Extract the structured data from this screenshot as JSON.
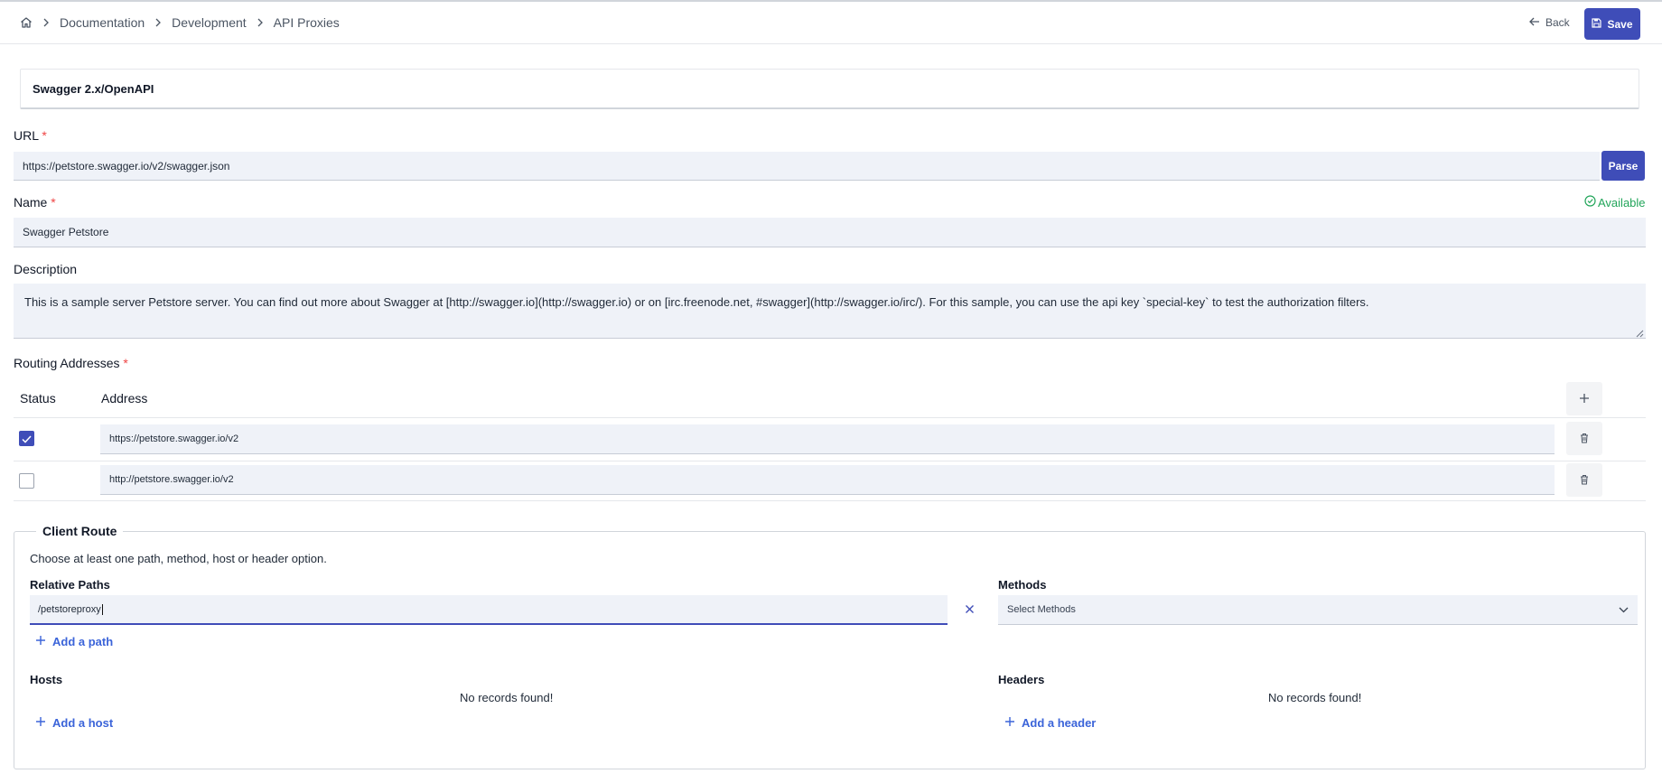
{
  "breadcrumb": {
    "items": [
      "Documentation",
      "Development",
      "API Proxies"
    ]
  },
  "header": {
    "back_label": "Back",
    "save_label": "Save"
  },
  "panel": {
    "title": "Swagger 2.x/OpenAPI"
  },
  "form": {
    "url_label": "URL",
    "url_value": "https://petstore.swagger.io/v2/swagger.json",
    "parse_label": "Parse",
    "name_label": "Name",
    "name_value": "Swagger Petstore",
    "name_status": "Available",
    "description_label": "Description",
    "description_value": "This is a sample server Petstore server.  You can find out more about Swagger at [http://swagger.io](http://swagger.io) or on [irc.freenode.net, #swagger](http://swagger.io/irc/).  For this sample, you can use the api key `special-key` to test the authorization filters.",
    "required_mark": "*"
  },
  "routing": {
    "label": "Routing Addresses",
    "col_status": "Status",
    "col_address": "Address",
    "rows": [
      {
        "checked": true,
        "address": "https://petstore.swagger.io/v2"
      },
      {
        "checked": false,
        "address": "http://petstore.swagger.io/v2"
      }
    ]
  },
  "client_route": {
    "legend": "Client Route",
    "hint": "Choose at least one path, method, host or header option.",
    "relative_paths_label": "Relative Paths",
    "path_value": "/petstoreproxy",
    "add_path_label": "Add a path",
    "methods_label": "Methods",
    "methods_placeholder": "Select Methods",
    "hosts_label": "Hosts",
    "hosts_empty": "No records found!",
    "add_host_label": "Add a host",
    "headers_label": "Headers",
    "headers_empty": "No records found!",
    "add_header_label": "Add a header"
  },
  "colors": {
    "primary": "#3f4db8",
    "success": "#22a55a",
    "link": "#3b64d9",
    "required": "#ef4444"
  }
}
